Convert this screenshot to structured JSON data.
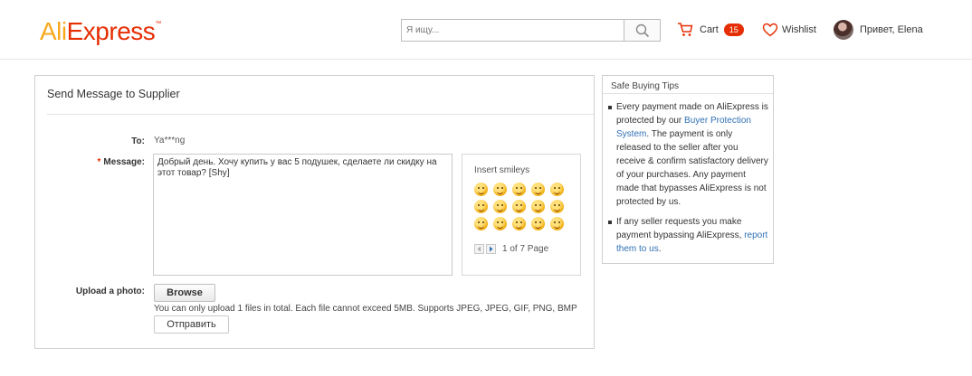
{
  "header": {
    "logo_ali": "Ali",
    "logo_express": "Express",
    "search_placeholder": "Я ищу...",
    "cart_label": "Cart",
    "cart_count": "15",
    "wishlist_label": "Wishlist",
    "user_greeting": "Привет, Elena"
  },
  "form": {
    "title": "Send Message to Supplier",
    "to_label": "To:",
    "to_value": "Ya***ng",
    "message_label": "Message:",
    "message_value": "Добрый день. Хочу купить у вас 5 подушек, сделаете ли скидку на этот товар? [Shy]",
    "smileys_title": "Insert smileys",
    "smileys_count": 15,
    "pager_text": "1 of 7 Page",
    "upload_label": "Upload a photo:",
    "browse_label": "Browse",
    "upload_hint": "You can only upload 1 files in total. Each file cannot exceed 5MB. Supports JPEG, JPEG, GIF, PNG, BMP",
    "send_label": "Отправить"
  },
  "tips": {
    "title": "Safe Buying Tips",
    "tip1_a": "Every payment made on AliExpress is protected by our ",
    "tip1_link": "Buyer Protection System",
    "tip1_b": ". The payment is only released to the seller after you receive & confirm satisfactory delivery of your purchases. Any payment made that bypasses AliExpress is not protected by us.",
    "tip2_a": "If any seller requests you make payment bypassing AliExpress, ",
    "tip2_link": "report them to us",
    "tip2_b": "."
  },
  "colors": {
    "brand_orange": "#e62e04",
    "brand_yellow": "#f7a81b",
    "link": "#2f6fb3"
  }
}
